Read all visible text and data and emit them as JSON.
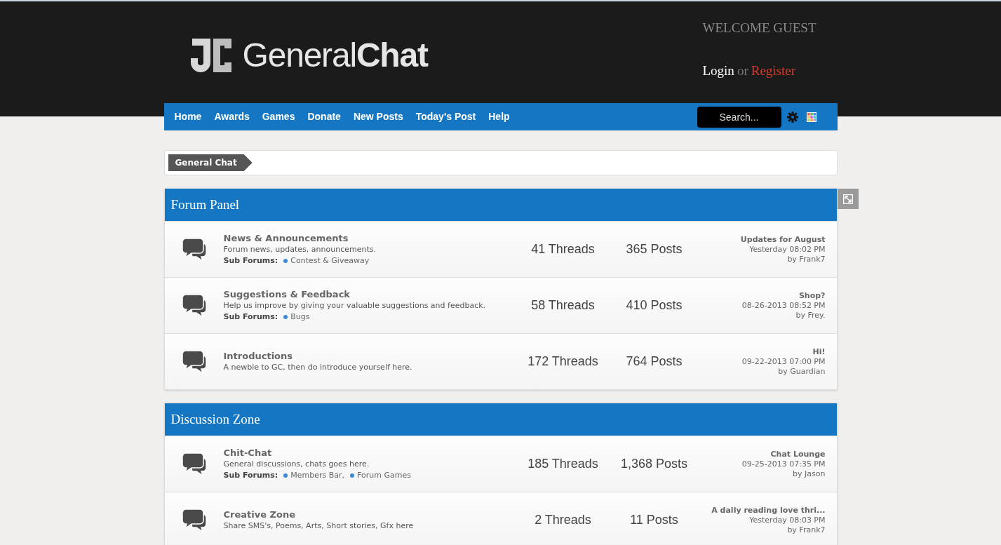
{
  "header": {
    "logo": "General**Chat**",
    "welcome": "WELCOME GUEST",
    "login": "Login",
    "or": "or",
    "register": "Register"
  },
  "nav": {
    "items": [
      "Home",
      "Awards",
      "Games",
      "Donate",
      "New Posts",
      "Today's Post",
      "Help"
    ],
    "search": {
      "placeholder": "Search..."
    }
  },
  "breadcrumb": [
    "General Chat"
  ],
  "sections": [
    {
      "title": "Forum Panel",
      "forums": [
        {
          "name": "News & Announcements",
          "description": "Forum news, updates, announcements.",
          "subforums_label": "Sub Forums:",
          "subforums": [
            "Contest & Giveaway"
          ],
          "threads": "41 Threads",
          "posts": "365 Posts",
          "last_title": "Updates for August",
          "last_time": "Yesterday 08:02 PM",
          "last_by": "by Frank7"
        },
        {
          "name": "Suggestions & Feedback",
          "description": "Help us improve by giving your valuable suggestions and feedback.",
          "subforums_label": "Sub Forums:",
          "subforums": [
            "Bugs"
          ],
          "threads": "58 Threads",
          "posts": "410 Posts",
          "last_title": "Shop?",
          "last_time": "08-26-2013 08:52 PM",
          "last_by": "by Frey."
        },
        {
          "name": "Introductions",
          "description": "A newbie to GC, then do introduce yourself here.",
          "threads": "172 Threads",
          "posts": "764 Posts",
          "last_title": "Hi!",
          "last_time": "09-22-2013 07:00 PM",
          "last_by": "by Guardian"
        }
      ]
    },
    {
      "title": "Discussion Zone",
      "forums": [
        {
          "name": "Chit-Chat",
          "description": "General discussions, chats goes here.",
          "subforums_label": "Sub Forums:",
          "subforums": [
            "Members Bar,",
            "Forum Games"
          ],
          "threads": "185 Threads",
          "posts": "1,368 Posts",
          "last_title": "Chat Lounge",
          "last_time": "09-25-2013 07:35 PM",
          "last_by": "by Jason"
        },
        {
          "name": "Creative Zone",
          "description": "Share SMS's, Poems, Arts, Short stories, Gfx here",
          "threads": "2 Threads",
          "posts": "11 Posts",
          "last_title": "A daily reading love thri...",
          "last_time": "Yesterday 08:03 PM",
          "last_by": "by Frank7"
        }
      ]
    }
  ]
}
